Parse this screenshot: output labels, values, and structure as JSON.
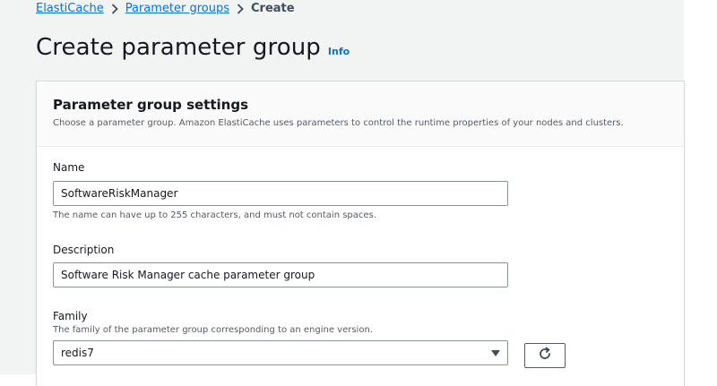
{
  "breadcrumb": {
    "items": [
      {
        "label": "ElastiCache"
      },
      {
        "label": "Parameter groups"
      }
    ],
    "current": "Create"
  },
  "header": {
    "title": "Create parameter group",
    "info": "Info"
  },
  "panel": {
    "title": "Parameter group settings",
    "description": "Choose a parameter group. Amazon ElastiCache uses parameters to control the runtime properties of your nodes and clusters."
  },
  "form": {
    "name": {
      "label": "Name",
      "value": "SoftwareRiskManager",
      "constraint": "The name can have up to 255 characters, and must not contain spaces."
    },
    "description": {
      "label": "Description",
      "value": "Software Risk Manager cache parameter group"
    },
    "family": {
      "label": "Family",
      "hint": "The family of the parameter group corresponding to an engine version.",
      "selected": "redis7"
    }
  },
  "icons": {
    "breadcrumb_separator": "chevron-right-icon",
    "select_caret": "caret-down-icon",
    "refresh": "refresh-icon"
  },
  "colors": {
    "link": "#0972d3",
    "page_background": "#f2f3f3",
    "panel_header_background": "#fafafa"
  }
}
